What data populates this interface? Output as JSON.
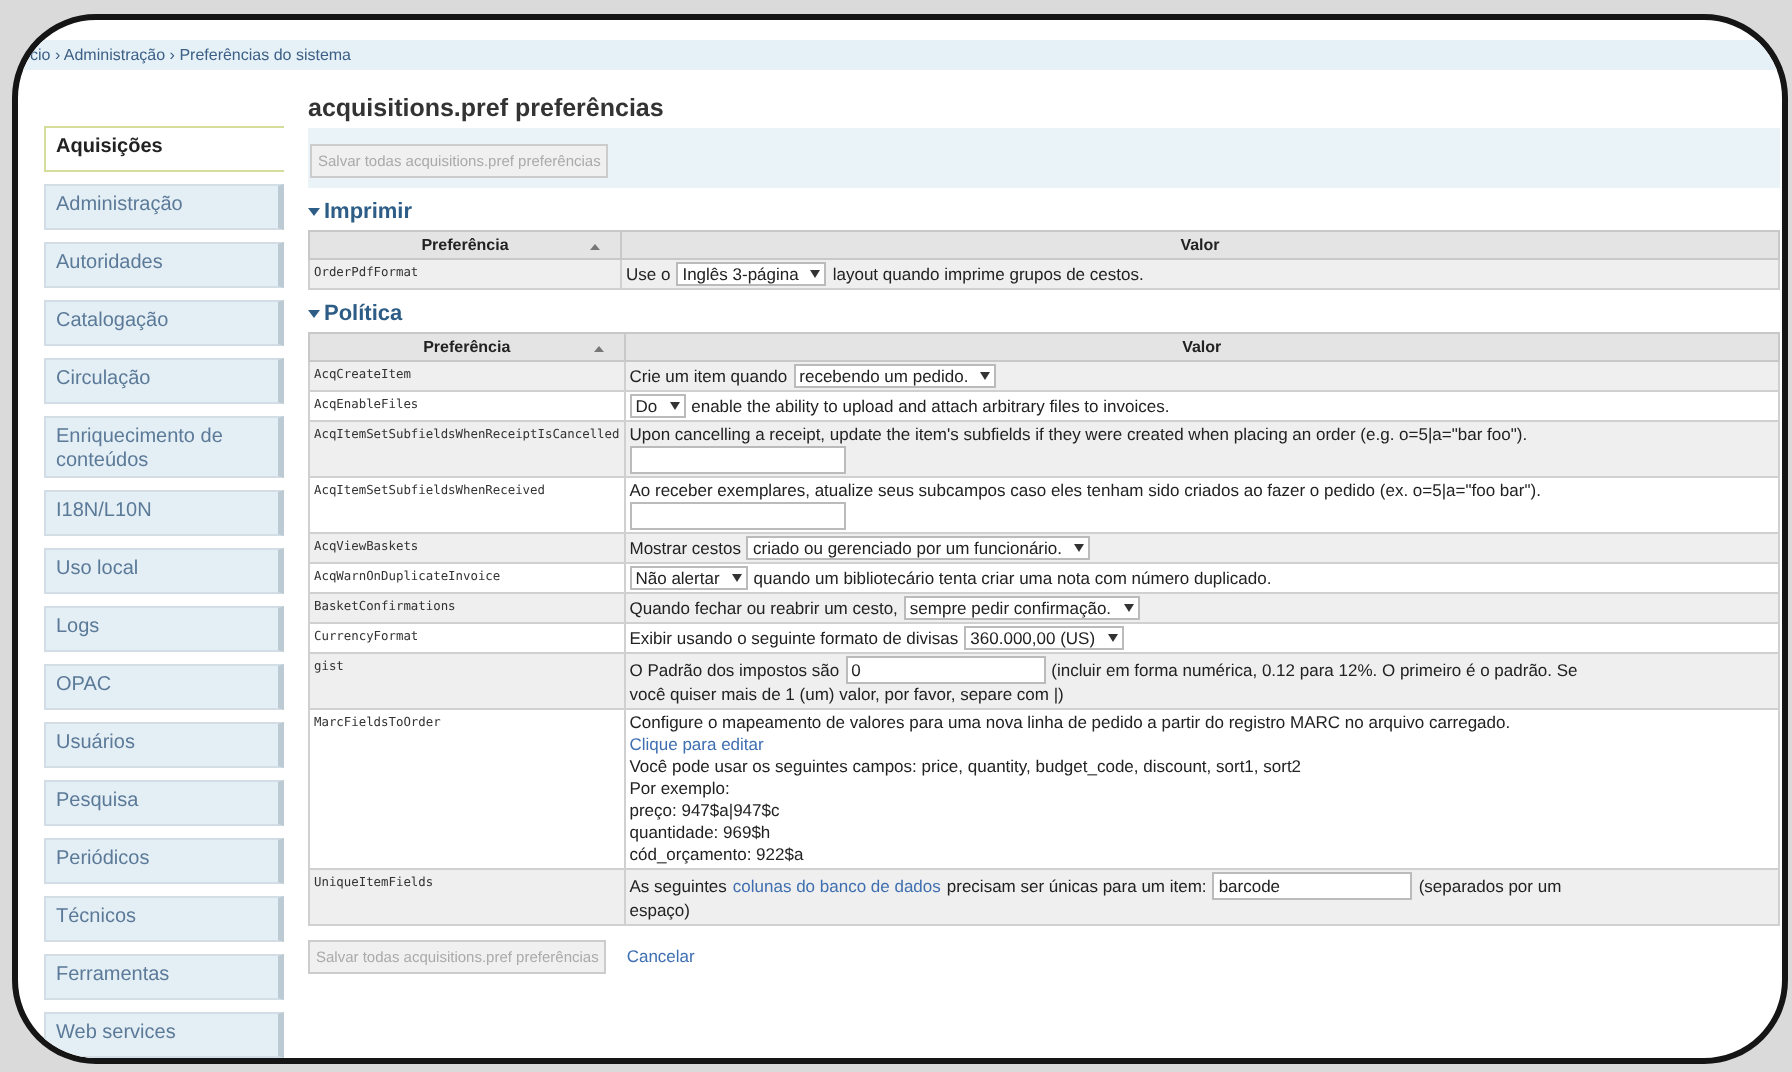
{
  "breadcrumb": "cio › Administração › Preferências do sistema",
  "sidebar": {
    "items": [
      {
        "label": "Aquisições",
        "selected": true
      },
      {
        "label": "Administração",
        "selected": false
      },
      {
        "label": "Autoridades",
        "selected": false
      },
      {
        "label": "Catalogação",
        "selected": false
      },
      {
        "label": "Circulação",
        "selected": false
      },
      {
        "label": "Enriquecimento de conteúdos",
        "selected": false
      },
      {
        "label": "I18N/L10N",
        "selected": false
      },
      {
        "label": "Uso local",
        "selected": false
      },
      {
        "label": "Logs",
        "selected": false
      },
      {
        "label": "OPAC",
        "selected": false
      },
      {
        "label": "Usuários",
        "selected": false
      },
      {
        "label": "Pesquisa",
        "selected": false
      },
      {
        "label": "Periódicos",
        "selected": false
      },
      {
        "label": "Técnicos",
        "selected": false
      },
      {
        "label": "Ferramentas",
        "selected": false
      },
      {
        "label": "Web services",
        "selected": false
      }
    ]
  },
  "title": "acquisitions.pref preferências",
  "save_button": {
    "label": "Salvar todas acquisitions.pref preferências",
    "disabled": true
  },
  "sections": [
    {
      "title": "Imprimir",
      "expanded": true,
      "columns": [
        "Preferência",
        "Valor"
      ],
      "rows": [
        {
          "name": "OrderPdfFormat",
          "value": [
            {
              "kind": "text",
              "text": "Use o"
            },
            {
              "kind": "select",
              "text": "Inglês 3-página"
            },
            {
              "kind": "text",
              "text": "layout quando imprime grupos de cestos."
            }
          ]
        }
      ]
    },
    {
      "title": "Política",
      "expanded": true,
      "columns": [
        "Preferência",
        "Valor"
      ],
      "rows": [
        {
          "name": "AcqCreateItem",
          "value": [
            {
              "kind": "text",
              "text": "Crie um item quando"
            },
            {
              "kind": "select",
              "text": "recebendo um pedido."
            }
          ]
        },
        {
          "name": "AcqEnableFiles",
          "value": [
            {
              "kind": "select",
              "text": "Do"
            },
            {
              "kind": "text",
              "text": "enable the ability to upload and attach arbitrary files to invoices."
            }
          ]
        },
        {
          "name": "AcqItemSetSubfieldsWhenReceiptIsCancelled",
          "value": [
            {
              "kind": "text",
              "text": "Upon cancelling a receipt, update the item's subfields if they were created when placing an order (e.g. o=5|a=\"bar foo\")."
            },
            {
              "kind": "break"
            },
            {
              "kind": "input"
            }
          ]
        },
        {
          "name": "AcqItemSetSubfieldsWhenReceived",
          "value": [
            {
              "kind": "text",
              "text": "Ao receber exemplares, atualize seus subcampos caso eles tenham sido criados ao fazer o pedido (ex. o=5|a=\"foo bar\")."
            },
            {
              "kind": "break"
            },
            {
              "kind": "input"
            }
          ]
        },
        {
          "name": "AcqViewBaskets",
          "value": [
            {
              "kind": "text",
              "text": "Mostrar cestos"
            },
            {
              "kind": "select",
              "text": "criado ou gerenciado por um funcionário."
            }
          ]
        },
        {
          "name": "AcqWarnOnDuplicateInvoice",
          "value": [
            {
              "kind": "select",
              "text": "Não alertar"
            },
            {
              "kind": "text",
              "text": "quando um bibliotecário tenta criar uma nota com número duplicado."
            }
          ]
        },
        {
          "name": "BasketConfirmations",
          "value": [
            {
              "kind": "text",
              "text": "Quando fechar ou reabrir um cesto,"
            },
            {
              "kind": "select",
              "text": "sempre pedir confirmação."
            }
          ]
        },
        {
          "name": "CurrencyFormat",
          "value": [
            {
              "kind": "text",
              "text": "Exibir usando o seguinte formato de divisas"
            },
            {
              "kind": "select",
              "text": "360.000,00 (US)"
            }
          ]
        },
        {
          "name": "gist",
          "value": [
            {
              "kind": "text",
              "text": "O Padrão dos impostos são"
            },
            {
              "kind": "input",
              "value": "0"
            },
            {
              "kind": "text",
              "text": "(incluir em forma numérica, 0.12 para 12%. O primeiro é o padrão. Se"
            },
            {
              "kind": "break"
            },
            {
              "kind": "text",
              "text": "você quiser mais de 1 (um) valor, por favor, separe com |)"
            }
          ]
        },
        {
          "name": "MarcFieldsToOrder",
          "value": [
            {
              "kind": "text",
              "text": "Configure o mapeamento de valores para uma nova linha de pedido a partir do registro MARC no arquivo carregado."
            },
            {
              "kind": "break"
            },
            {
              "kind": "link",
              "text": "Clique para editar"
            },
            {
              "kind": "break"
            },
            {
              "kind": "text",
              "text": "Você pode usar os seguintes campos: price, quantity, budget_code, discount, sort1, sort2"
            },
            {
              "kind": "break"
            },
            {
              "kind": "text",
              "text": "Por exemplo:"
            },
            {
              "kind": "break"
            },
            {
              "kind": "text",
              "text": "preço: 947$a|947$c"
            },
            {
              "kind": "break"
            },
            {
              "kind": "text",
              "text": "quantidade: 969$h"
            },
            {
              "kind": "break"
            },
            {
              "kind": "text",
              "text": "cód_orçamento: 922$a"
            }
          ]
        },
        {
          "name": "UniqueItemFields",
          "value": [
            {
              "kind": "text",
              "text": "As seguintes"
            },
            {
              "kind": "link",
              "text": "colunas do banco de dados"
            },
            {
              "kind": "text",
              "text": "precisam ser únicas para um item:"
            },
            {
              "kind": "input",
              "value": "barcode"
            },
            {
              "kind": "text",
              "text": "(separados por um"
            },
            {
              "kind": "break"
            },
            {
              "kind": "text",
              "text": "espaço)"
            }
          ]
        }
      ]
    }
  ],
  "footer": {
    "save_button": {
      "label": "Salvar todas acquisitions.pref preferências",
      "disabled": true
    },
    "cancel_link": "Cancelar"
  }
}
